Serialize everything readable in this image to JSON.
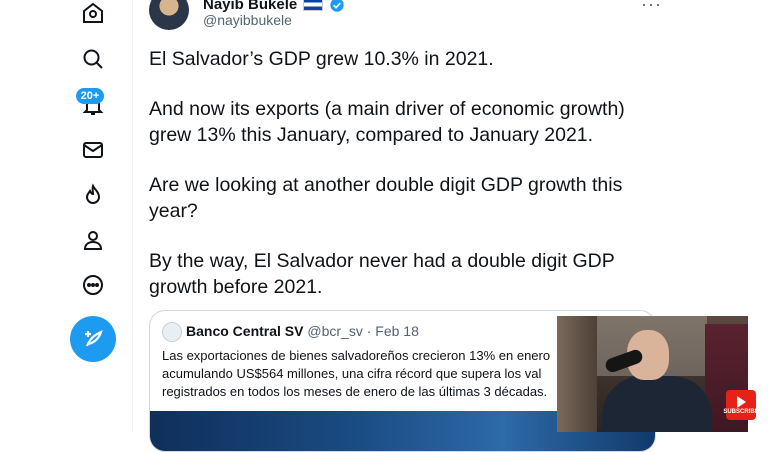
{
  "nav": {
    "notifications_badge": "20+"
  },
  "tweet": {
    "author_name": "Nayib Bukele",
    "author_handle": "@nayibbukele",
    "paragraphs": [
      "El Salvador’s GDP grew 10.3% in 2021.",
      "And now its exports (a main driver of economic growth) grew 13% this January, compared to January 2021.",
      "Are we looking at another double digit GDP growth this year?",
      "By the way, El Salvador never had a double digit GDP growth before 2021."
    ]
  },
  "quote": {
    "name": "Banco Central SV",
    "handle": "@bcr_sv",
    "date": "Feb 18",
    "lines": [
      "Las exportaciones de bienes salvadoreños crecieron 13% en enero",
      "acumulando US$564 millones, una cifra récord que supera los val",
      "registrados en todos los meses de enero de las últimas 3 décadas."
    ]
  },
  "overlay": {
    "subscribe_label": "SUBSCRIBE"
  },
  "colors": {
    "accent": "#1d9bf0",
    "text_primary": "#0f1419",
    "text_secondary": "#536471",
    "subscribe_red": "#e62117"
  }
}
